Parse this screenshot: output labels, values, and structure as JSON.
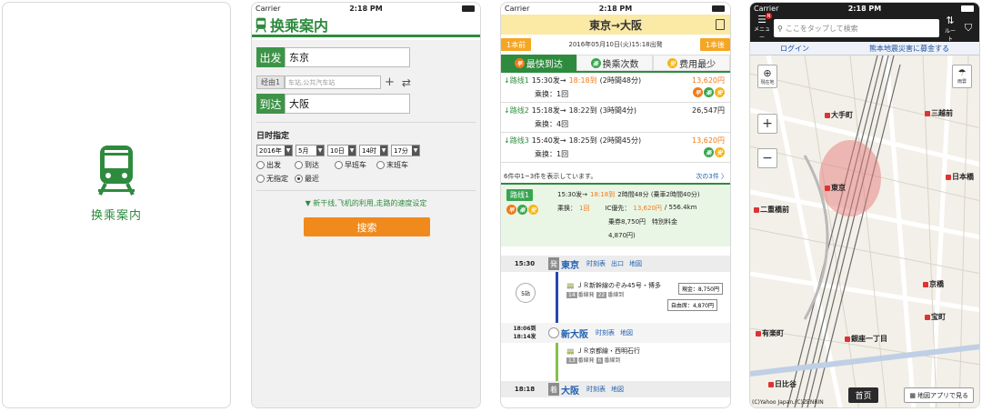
{
  "status": {
    "carrier": "Carrier",
    "time": "2:18 PM"
  },
  "splash": {
    "label": "换乘案内"
  },
  "search": {
    "title": "换乘案内",
    "from_label": "出发",
    "from_value": "东京",
    "via_label": "经由1",
    "via_placeholder": "车站,公共汽车站",
    "to_label": "到达",
    "to_value": "大阪",
    "datetime_label": "日时指定",
    "selects": [
      "2016年",
      "5月",
      "10日",
      "14时",
      "17分"
    ],
    "radios": [
      "出发",
      "到达",
      "早班车",
      "末班车",
      "无指定",
      "最近"
    ],
    "more_link": "▼ 新干线,飞机的利用,走路的速度设定",
    "search_button": "搜索"
  },
  "results": {
    "title": "東京→大阪",
    "prev": "1本前",
    "next": "1本後",
    "date": "2016年05月10日(火)15:18出発",
    "tabs": [
      "最快到达",
      "换乘次数",
      "费用最少"
    ],
    "routes": [
      {
        "no": "↓路线1",
        "time": "15:30发→",
        "arr": "18:18到",
        "dur": "(2時間48分)",
        "price": "13,620円",
        "transfer": "乘换：1回"
      },
      {
        "no": "↓路线2",
        "time": "15:18发→",
        "arr": "18:22到",
        "dur": "(3時間4分)",
        "price": "26,547円",
        "transfer": "乘换：4回"
      },
      {
        "no": "↓路线3",
        "time": "15:40发→",
        "arr": "18:25到",
        "dur": "(2時間45分)",
        "price": "13,620円",
        "transfer": "乘换：1回"
      }
    ],
    "count_text": "6件中1~3件を表示しています。",
    "next_link": "次の3件 〉",
    "detail": {
      "tag": "路线1",
      "line1a": "15:30发→",
      "line1b": "18:18到",
      "line1c": "2時間48分 (乗車2時間40分)",
      "line2a": "乘换：",
      "line2b": "1回",
      "line2c": "IC優先：",
      "line2d": "13,620円",
      "line2e": "/ 556.4km",
      "line3": "乗券8,750円　特別料金",
      "line4": "4,870円)"
    },
    "stations": [
      {
        "time": "15:30",
        "badge": "発",
        "name": "東京",
        "links": [
          "时刻表",
          "出口",
          "地図"
        ]
      },
      {
        "time": "18:06到\n18:14发",
        "badge": "",
        "name": "新大阪",
        "links": [
          "时刻表",
          "地図"
        ]
      },
      {
        "time": "18:18",
        "badge": "着",
        "name": "大阪",
        "links": [
          "时刻表",
          "地図"
        ]
      }
    ],
    "trains": [
      {
        "name": "ＪＲ新幹線のぞみ45号・博多",
        "plat1": "14",
        "plat1t": "番線発",
        "plat2": "22",
        "plat2t": "番線到"
      },
      {
        "name": "ＪＲ京都線・西明石行",
        "plat1": "13",
        "plat1t": "番線発",
        "plat2": "6",
        "plat2t": "番線到"
      }
    ],
    "stops": "5站",
    "fare_cash": "現金：8,750円",
    "fare_free": "自由席：4,870円"
  },
  "map": {
    "search_placeholder": "ここをタップして検索",
    "menu_label": "メニュー",
    "route_label": "ルート",
    "login": "ログイン",
    "donate": "熊本地震災害に募金する",
    "current_label": "現在地",
    "rain_label": "雨雲",
    "zoom_in": "+",
    "zoom_out": "−",
    "pois": [
      "大手町",
      "三越前",
      "日本橋",
      "東京",
      "京橋",
      "二重橋前",
      "宝町",
      "銀座一丁目",
      "有楽町",
      "日比谷"
    ],
    "copyright": "(C)Yahoo Japan,(C)ZENRIN",
    "home": "首页",
    "app_button": "地図アプリで見る"
  },
  "colors": {
    "green": "#2e8b3e",
    "orange": "#f08a1c",
    "yellow": "#fbe9a6",
    "blue": "#2060b0"
  }
}
